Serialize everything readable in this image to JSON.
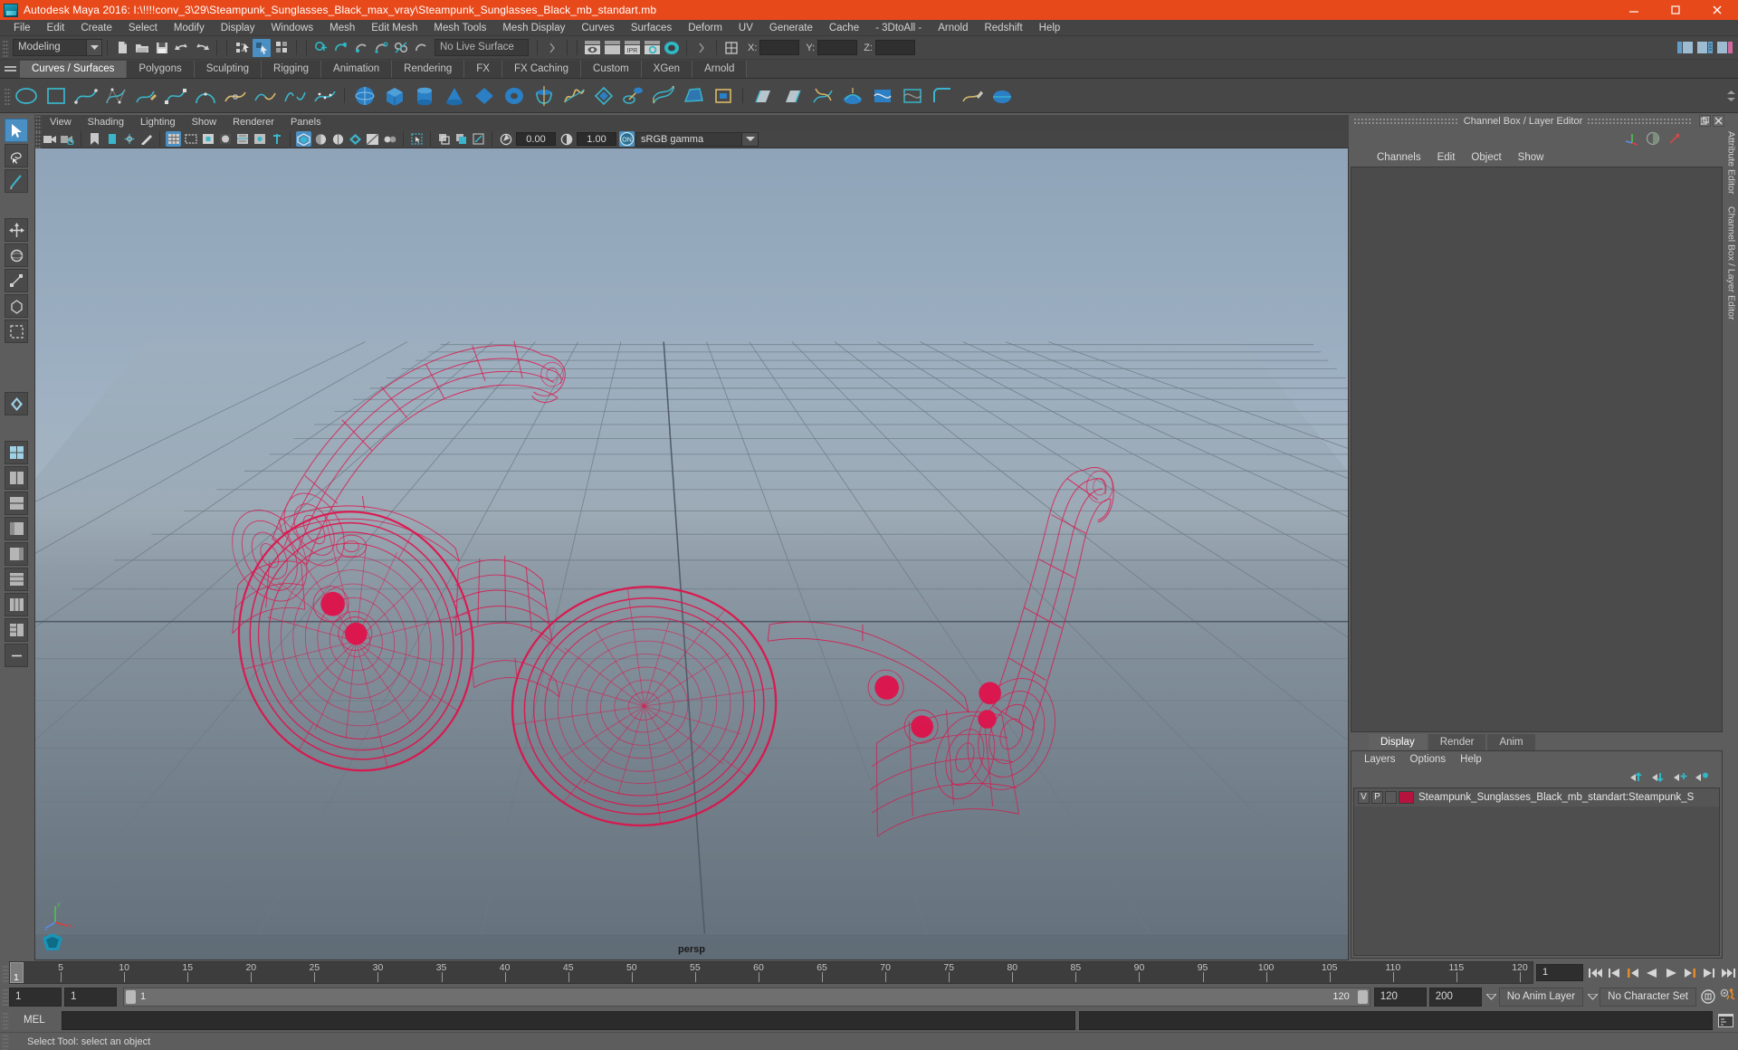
{
  "titlebar": {
    "title": "Autodesk Maya 2016: I:\\!!!!conv_3\\29\\Steampunk_Sunglasses_Black_max_vray\\Steampunk_Sunglasses_Black_mb_standart.mb",
    "logo_icon": "maya-logo-icon",
    "minimize_icon": "minimize-icon",
    "maximize_icon": "maximize-icon",
    "close_icon": "close-icon"
  },
  "menubar": {
    "items": [
      "File",
      "Edit",
      "Create",
      "Select",
      "Modify",
      "Display",
      "Windows",
      "Mesh",
      "Edit Mesh",
      "Mesh Tools",
      "Mesh Display",
      "Curves",
      "Surfaces",
      "Deform",
      "UV",
      "Generate",
      "Cache",
      "- 3DtoAll -",
      "Arnold",
      "Redshift",
      "Help"
    ]
  },
  "statusbar": {
    "mode": "Modeling",
    "live_surface": "No Live Surface",
    "x_label": "X:",
    "y_label": "Y:",
    "z_label": "Z:",
    "x_value": "",
    "y_value": "",
    "z_value": ""
  },
  "shelf": {
    "tabs": [
      "Curves / Surfaces",
      "Polygons",
      "Sculpting",
      "Rigging",
      "Animation",
      "Rendering",
      "FX",
      "FX Caching",
      "Custom",
      "XGen",
      "Arnold"
    ],
    "selected_tab": "Curves / Surfaces"
  },
  "viewport": {
    "menu": [
      "View",
      "Shading",
      "Lighting",
      "Show",
      "Renderer",
      "Panels"
    ],
    "exposure": "0.00",
    "gamma": "1.00",
    "color_management": "sRGB gamma",
    "camera_label": "persp",
    "gizmo_x": "x",
    "gizmo_y": "y",
    "gizmo_z": "z",
    "wireframe_color": "#e0114a",
    "sky_top_color": "#8fa4b8",
    "sky_bottom_color": "#5f6b75"
  },
  "channelbox": {
    "panel_title": "Channel Box / Layer Editor",
    "menu": [
      "Channels",
      "Edit",
      "Object",
      "Show"
    ],
    "attribute_editor_tab": "Attribute Editor",
    "channel_box_tab": "Channel Box / Layer Editor",
    "undock_icon": "undock-icon",
    "close_icon": "close-panel-icon"
  },
  "layereditor": {
    "tabs": [
      "Display",
      "Render",
      "Anim"
    ],
    "selected_tab": "Display",
    "menu": [
      "Layers",
      "Options",
      "Help"
    ],
    "layers": [
      {
        "visibility": "V",
        "playback": "P",
        "shading": "",
        "color": "#b5123e",
        "name": "Steampunk_Sunglasses_Black_mb_standart:Steampunk_S"
      }
    ],
    "tool_icons": [
      "move-layer-up-icon",
      "move-layer-down-icon",
      "new-layer-icon",
      "new-layer-from-selected-icon"
    ]
  },
  "timeline": {
    "start": 1,
    "end": 120,
    "current_frame": "1",
    "ticks": [
      5,
      10,
      15,
      20,
      25,
      30,
      35,
      40,
      45,
      50,
      55,
      60,
      65,
      70,
      75,
      80,
      85,
      90,
      95,
      100,
      105,
      110,
      115,
      120
    ],
    "end_marker": "120",
    "current_frame_field": "1",
    "playback_icons": [
      "go-to-start-icon",
      "step-back-key-icon",
      "step-back-frame-icon",
      "play-backwards-icon",
      "play-forwards-icon",
      "step-forward-frame-icon",
      "step-forward-key-icon",
      "go-to-end-icon"
    ]
  },
  "rangeslider": {
    "anim_start": "1",
    "range_start": "1",
    "bar_start_label": "1",
    "bar_end_label": "120",
    "range_end": "120",
    "anim_end": "200",
    "anim_layer": "No Anim Layer",
    "character_set": "No Character Set",
    "auto_key_icon": "auto-keyframe-icon",
    "anim_prefs_icon": "animation-preferences-icon"
  },
  "commandline": {
    "language": "MEL",
    "input_value": "",
    "output_value": "",
    "script_editor_icon": "script-editor-icon"
  },
  "statusline": {
    "message": "Select Tool: select an object"
  },
  "toolbox": {
    "tools": [
      "select-tool",
      "lasso-select-tool",
      "paint-select-tool",
      "move-tool",
      "rotate-tool",
      "scale-tool",
      "universal-manipulator",
      "soft-select-tool",
      "last-tool-used",
      "view-layout-single",
      "view-layout-four",
      "view-layout-split",
      "view-layout-persp-outliner",
      "view-layout-hypergraph",
      "view-layout-extra-1",
      "view-layout-extra-2",
      "view-layout-extra-3",
      "view-layout-more"
    ],
    "selected_tool": "select-tool"
  }
}
